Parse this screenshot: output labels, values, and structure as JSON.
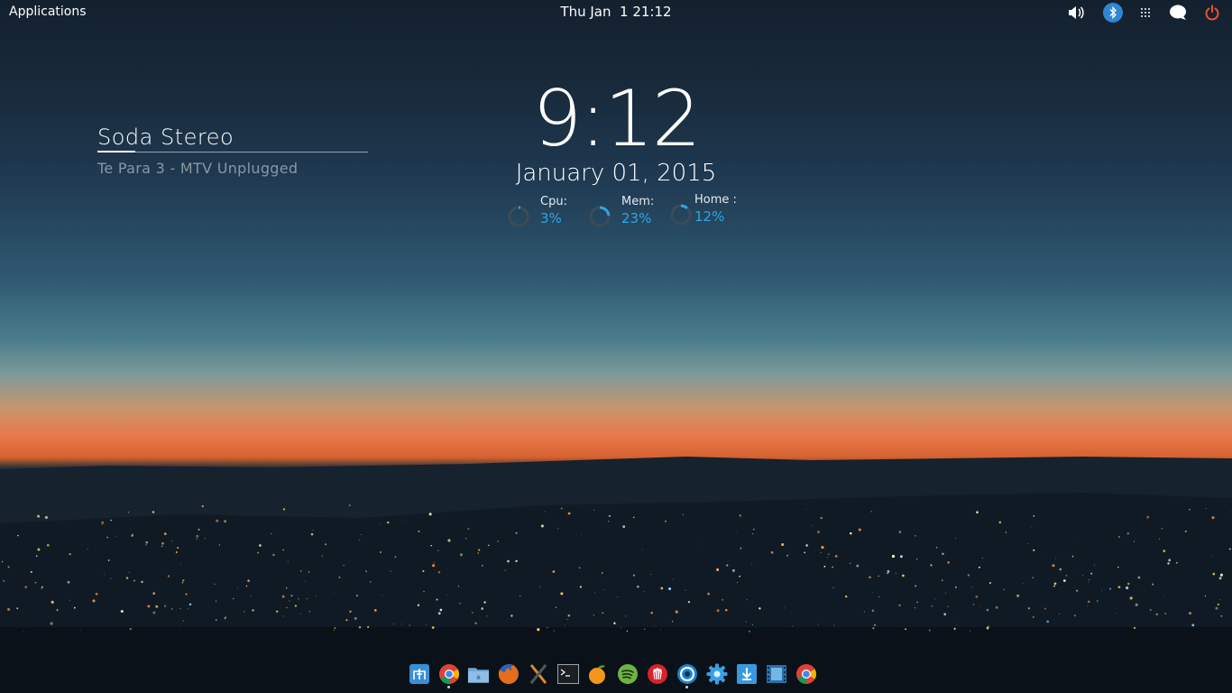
{
  "topbar": {
    "applications_label": "Applications",
    "clock": "Thu Jan  1 21:12"
  },
  "tray_icons": [
    "volume-icon",
    "bluetooth-icon",
    "grid-icon",
    "chat-icon",
    "power-icon"
  ],
  "music": {
    "artist": "Soda Stereo",
    "track": "Te Para 3 - MTV Unplugged"
  },
  "clock_widget": {
    "time": "9:12",
    "date": "January 01, 2015"
  },
  "stats": {
    "cpu": {
      "label": "Cpu:",
      "value": "3%",
      "fraction": 0.03
    },
    "mem": {
      "label": "Mem:",
      "value": "23%",
      "fraction": 0.23
    },
    "home": {
      "label": "Home :",
      "value": "12%",
      "fraction": 0.12
    }
  },
  "colors": {
    "accent": "#2ea6e6",
    "power": "#e8552a",
    "bluetooth_bg": "#2f86d6"
  },
  "dock_icons": [
    "app-store-icon",
    "chrome-icon",
    "files-icon",
    "firefox-icon",
    "x-app-icon",
    "terminal-icon",
    "orange-app-icon",
    "spotify-icon",
    "popcorn-icon",
    "steam-ring-icon",
    "settings-gear-icon",
    "downloads-icon",
    "video-player-icon",
    "chrome-browser-icon"
  ]
}
